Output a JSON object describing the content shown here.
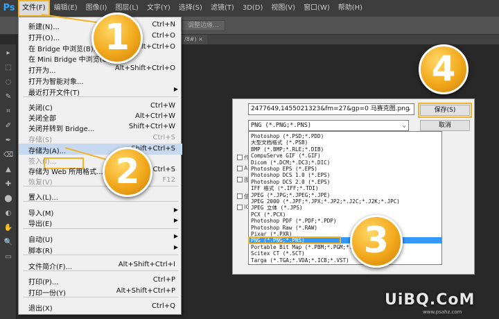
{
  "app": {
    "logo": "Ps"
  },
  "menubar": [
    {
      "label": "文件(F)",
      "active": true
    },
    {
      "label": "编辑(E)"
    },
    {
      "label": "图像(I)"
    },
    {
      "label": "图层(L)"
    },
    {
      "label": "文字(Y)"
    },
    {
      "label": "选择(S)"
    },
    {
      "label": "滤镜(T)"
    },
    {
      "label": "3D(D)"
    },
    {
      "label": "视图(V)"
    },
    {
      "label": "窗口(W)"
    },
    {
      "label": "帮助(H)"
    }
  ],
  "optbar": {
    "button": "调整边缘..."
  },
  "doc_tab": "/8#) ×",
  "file_menu": {
    "items": [
      {
        "label": "新建(N)...",
        "shortcut": "Ctrl+N"
      },
      {
        "label": "打开(O)...",
        "shortcut": "Ctrl+O"
      },
      {
        "label": "在 Bridge 中浏览(B)...",
        "shortcut": "Alt+Ctrl+O"
      },
      {
        "label": "在 Mini Bridge 中浏览(G)...",
        "shortcut": ""
      },
      {
        "label": "打开为...",
        "shortcut": "Alt+Shift+Ctrl+O"
      },
      {
        "label": "打开为智能对象...",
        "shortcut": ""
      },
      {
        "label": "最近打开文件(T)",
        "shortcut": "",
        "submenu": true
      },
      {
        "label": "关闭(C)",
        "shortcut": "Ctrl+W"
      },
      {
        "label": "关闭全部",
        "shortcut": "Alt+Ctrl+W"
      },
      {
        "label": "关闭并转到 Bridge...",
        "shortcut": "Shift+Ctrl+W"
      },
      {
        "label": "存储(S)",
        "shortcut": "Ctrl+S",
        "disabled": true
      },
      {
        "label": "存储为(A)...",
        "shortcut": "Shift+Ctrl+S",
        "highlight": true
      },
      {
        "label": "签入(I)...",
        "shortcut": "",
        "disabled": true
      },
      {
        "label": "存储为 Web 所用格式...",
        "shortcut": "Alt+Shift+Ctrl+S"
      },
      {
        "label": "恢复(V)",
        "shortcut": "F12",
        "disabled": true
      },
      {
        "label": "置入(L)...",
        "shortcut": ""
      },
      {
        "label": "导入(M)",
        "shortcut": "",
        "submenu": true
      },
      {
        "label": "导出(E)",
        "shortcut": "",
        "submenu": true
      },
      {
        "label": "自动(U)",
        "shortcut": "",
        "submenu": true
      },
      {
        "label": "脚本(R)",
        "shortcut": "",
        "submenu": true
      },
      {
        "label": "文件简介(F)...",
        "shortcut": "Alt+Shift+Ctrl+I"
      },
      {
        "label": "打印(P)...",
        "shortcut": "Ctrl+P"
      },
      {
        "label": "打印一份(Y)",
        "shortcut": "Alt+Shift+Ctrl+P"
      },
      {
        "label": "退出(X)",
        "shortcut": "Ctrl+Q"
      }
    ]
  },
  "badges": [
    "1",
    "2",
    "3",
    "4"
  ],
  "dialog": {
    "filename": "2477649,1455021323&fm=27&gp=0 马赛克图.png",
    "format_selected": "PNG (*.PNG;*.PNS)",
    "save_button": "保存(S)",
    "cancel_button": "取消",
    "left_stubs": [
      "作",
      "A",
      "图",
      "使",
      "IC"
    ],
    "formats": [
      "Photoshop (*.PSD;*.PDD)",
      "大型文档格式 (*.PSB)",
      "BMP (*.BMP;*.RLE;*.DIB)",
      "CompuServe GIF (*.GIF)",
      "Dicom (*.DCM;*.DC3;*.DIC)",
      "Photoshop EPS (*.EPS)",
      "Photoshop DCS 1.0 (*.EPS)",
      "Photoshop DCS 2.0 (*.EPS)",
      "IFF 格式 (*.IFF;*.TDI)",
      "JPEG (*.JPG;*.JPEG;*.JPE)",
      "JPEG 2000 (*.JPF;*.JPX;*.JP2;*.J2C;*.J2K;*.JPC)",
      "JPEG 立体 (*.JPS)",
      "PCX (*.PCX)",
      "Photoshop PDF (*.PDF;*.PDP)",
      "Photoshop Raw (*.RAW)",
      "Pixar (*.PXR)",
      "PNG (*.PNG;*.PNS)",
      "Portable Bit Map (*.PBM;*.PGM;*.PPM;*.PAM)",
      "Scitex CT (*.SCT)",
      "Targa (*.TGA;*.VDA;*.ICB;*.VST)"
    ]
  },
  "watermark": {
    "text": "UiBQ.CoM",
    "sub": "www.psahz.com"
  }
}
